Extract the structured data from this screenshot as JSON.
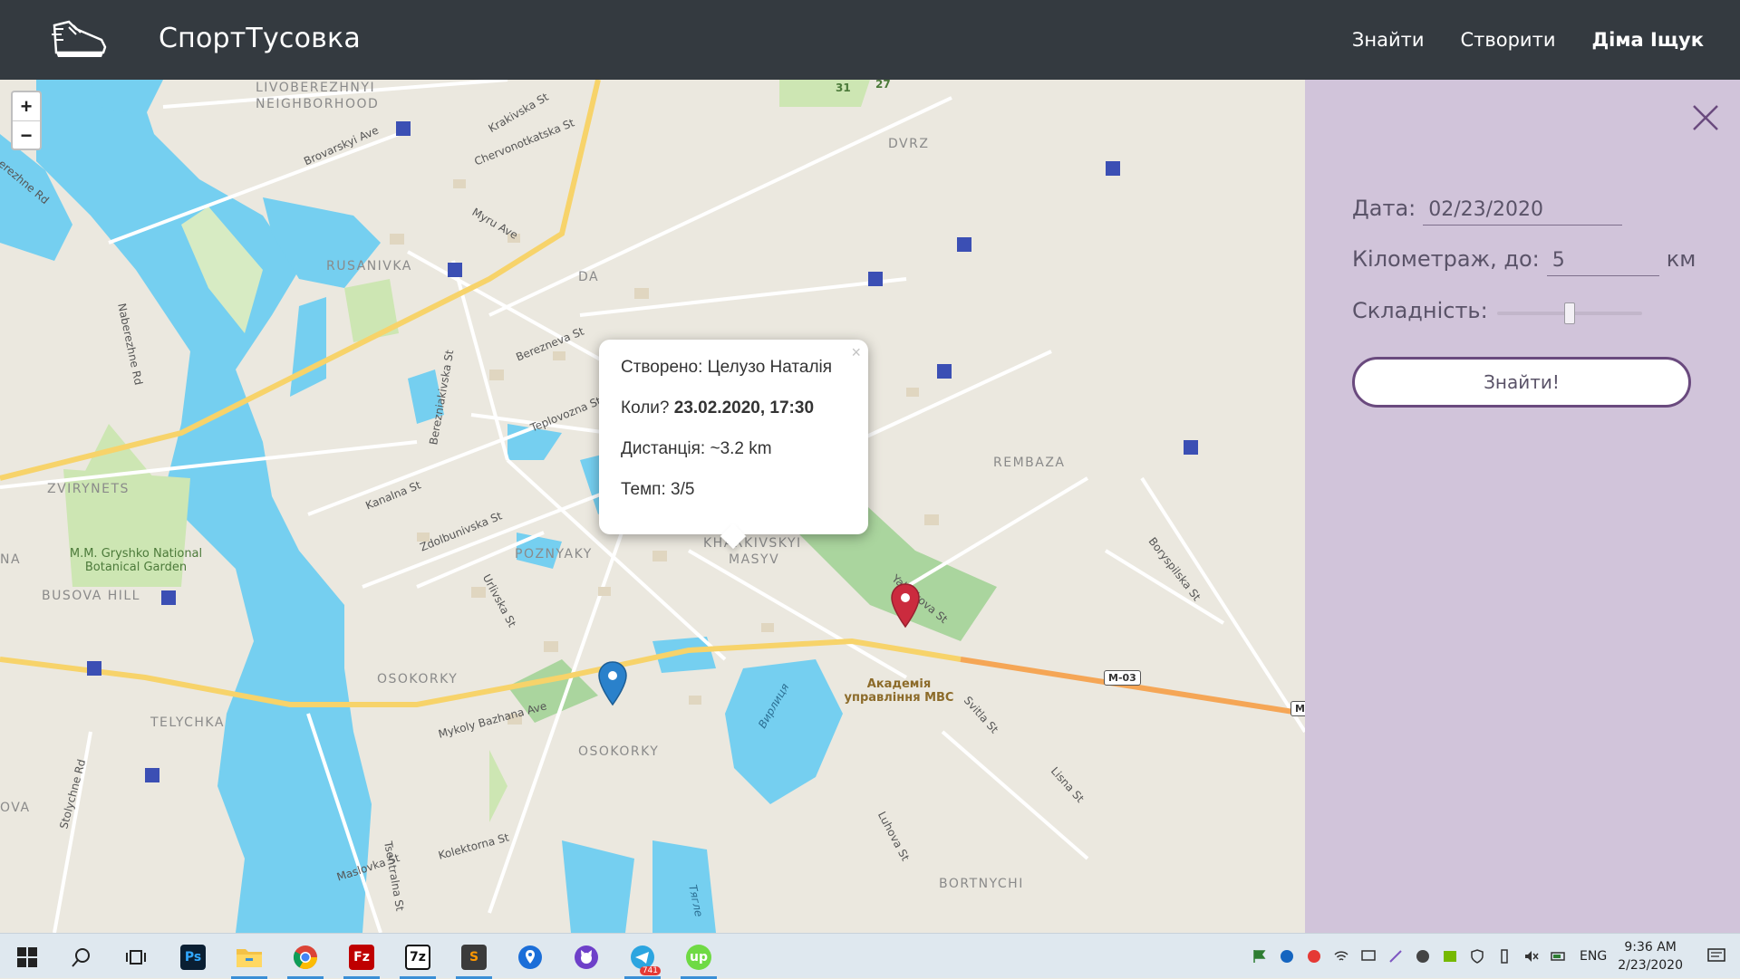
{
  "header": {
    "brand": "СпортТусовка",
    "nav": {
      "find": "Знайти",
      "create": "Створити",
      "user": "Діма Іщук"
    }
  },
  "map": {
    "zoom_in": "+",
    "zoom_out": "−",
    "area_labels": {
      "livoberezhnyi": "LIVOBEREZHNYI",
      "neighborhood": "NEIGHBORHOOD",
      "dvrz": "DVRZ",
      "rusanivka": "RUSANIVKA",
      "rembaza": "REMBAZA",
      "zvirynets": "ZVIRYNETS",
      "poznyaky": "POZNYAKY",
      "kharkivskyi": "KHARKIVSKYI",
      "masyv": "MASYV",
      "busova_hill": "BUSOVA HILL",
      "osokorky_n": "OSOKORKY",
      "telychka": "TELYCHKA",
      "osokorky_s": "OSOKORKY",
      "bortnychi": "BORTNYCHI",
      "na": "NA",
      "ova": "OVA",
      "da": "DA"
    },
    "street_labels": {
      "brovarskyi": "Brovarskyi Ave",
      "krakivska": "Krakivska St",
      "chervonotkatska": "Chervonotkatska St",
      "myru": "Myru Ave",
      "naberezhne": "Naberezhne Rd",
      "berezhne": "erezhne Rd",
      "berezneva": "Berezneva St",
      "bereznia": "Berezniakivska St",
      "teplovozna": "Teplovozna St",
      "kanalna": "Kanalna St",
      "zdolbunivska": "Zdolbunivska St",
      "urlivska": "Urlivska St",
      "borysp": "Boryspilska St",
      "yalynkova": "Yalynkova St",
      "bazhana": "Mykoly Bazhana Ave",
      "svitla": "Svitla St",
      "stolychne": "Stolychne Rd",
      "maslovka": "Maslovka St",
      "kolektorna": "Kolektorna St",
      "tsentralna": "Tsentralna St",
      "luhova": "Luhova St",
      "lisna": "Lisna St",
      "vyrlytsia": "Вирлиця",
      "tiahle": "Тягле"
    },
    "route_badges": {
      "m03": "M-03",
      "m": "M"
    },
    "garden": "M.M. Gryshko National Botanical Garden",
    "academy": "Академія управління МВС",
    "poi_numbers": {
      "n27": "27",
      "n31": "31"
    },
    "popup": {
      "close": "×",
      "created_label": "Створено:",
      "created_by": "Целузо Наталія",
      "when_label": "Коли?",
      "when_value": "23.02.2020, 17:30",
      "distance_label": "Дистанція:",
      "distance_value": "~3.2 km",
      "pace_label": "Темп:",
      "pace_value": "3/5"
    }
  },
  "panel": {
    "date_label": "Дата:",
    "date_value": "02/23/2020",
    "distance_label": "Кілометраж, до:",
    "distance_value": "5",
    "distance_unit": "км",
    "difficulty_label": "Складність:",
    "difficulty_level": 0.5,
    "find_button": "Знайти!"
  },
  "taskbar": {
    "apps": [
      "windows-start",
      "search",
      "task-view",
      "photoshop",
      "file-explorer",
      "chrome",
      "filezilla",
      "7zip",
      "sublime-text",
      "maps",
      "github",
      "telegram",
      "upwork"
    ],
    "telegram_badge": "741",
    "photoshop_label": "Ps",
    "filezilla_label": "Fz",
    "zip_label": "7z",
    "sublime_label": "S",
    "upwork_label": "up",
    "lang": "ENG",
    "time": "9:36 AM",
    "date": "2/23/2020"
  },
  "colors": {
    "header_bg": "#343a40",
    "panel_bg": "#d1c4da",
    "button_border": "#6a4a7e",
    "marker_blue": "#2a81cb",
    "marker_red": "#cb2b3e",
    "water": "#75cff0",
    "road_major": "#f7d36a"
  }
}
